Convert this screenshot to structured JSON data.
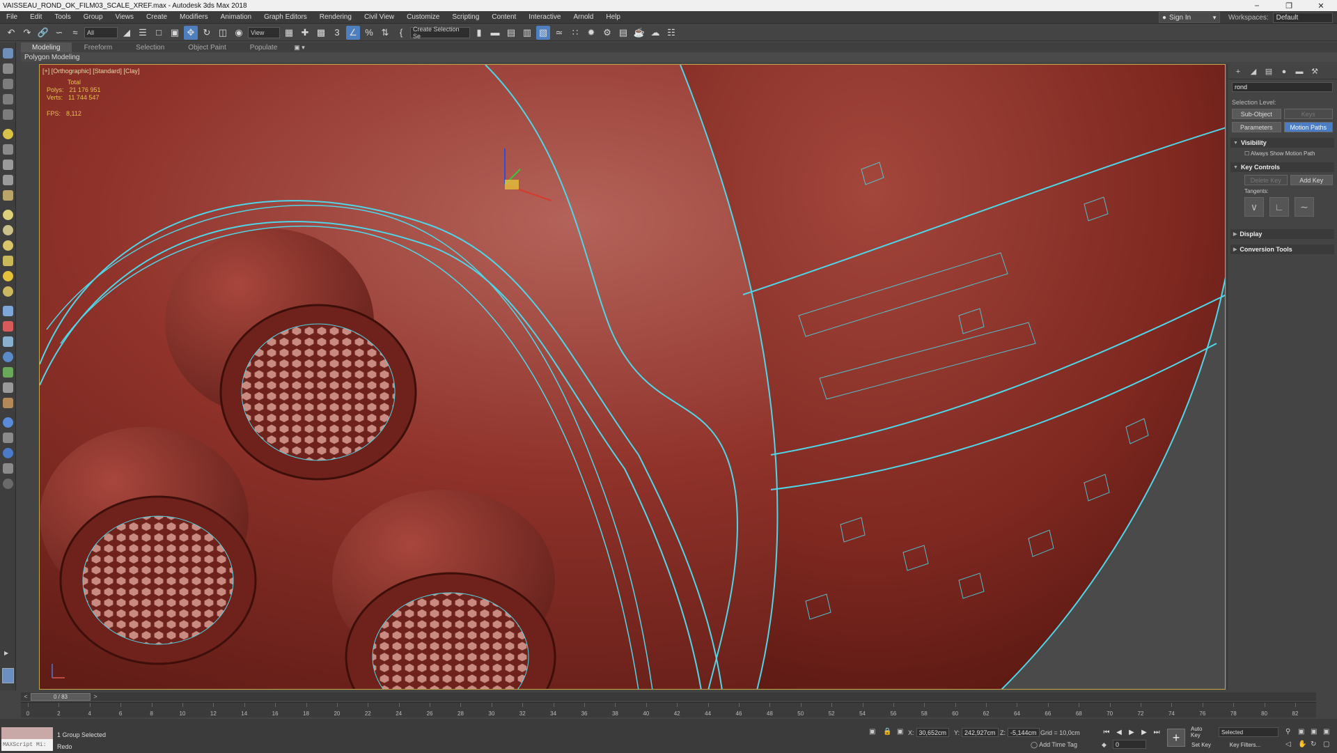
{
  "window": {
    "title": "VAISSEAU_ROND_OK_FILM03_SCALE_XREF.max - Autodesk 3ds Max 2018"
  },
  "menu": {
    "items": [
      "File",
      "Edit",
      "Tools",
      "Group",
      "Views",
      "Create",
      "Modifiers",
      "Animation",
      "Graph Editors",
      "Rendering",
      "Civil View",
      "Customize",
      "Scripting",
      "Content",
      "Interactive",
      "Arnold",
      "Help"
    ],
    "sign_in": "Sign In",
    "workspaces_label": "Workspaces:",
    "workspaces_value": "Default"
  },
  "toolbar": {
    "selection_filter": "All",
    "ref_coord": "View",
    "named_selection": "Create Selection Se"
  },
  "ribbon": {
    "tabs": [
      "Modeling",
      "Freeform",
      "Selection",
      "Object Paint",
      "Populate"
    ],
    "active_tab": "Modeling",
    "subpanel": "Polygon Modeling"
  },
  "viewport": {
    "label": "[+] [Orthographic] [Standard] [Clay]",
    "stats": {
      "total_label": "Total",
      "polys_label": "Polys:",
      "polys_value": "21 176 951",
      "verts_label": "Verts:",
      "verts_value": "11 744 547",
      "fps_label": "FPS:",
      "fps_value": "8,112"
    },
    "colors": {
      "surface": "#8a2f28",
      "highlight": "#b65a52",
      "shadow": "#5a1812",
      "edge": "#4fd6e8",
      "background": "#4a4a4a"
    }
  },
  "command_panel": {
    "object_name": "rond",
    "selection_level_label": "Selection Level:",
    "sub_object": "Sub-Object",
    "keys": "Keys",
    "parameters": "Parameters",
    "motion_paths": "Motion Paths",
    "visibility": "Visibility",
    "always_show": "Always Show Motion Path",
    "key_controls": "Key Controls",
    "delete_key": "Delete Key",
    "add_key": "Add Key",
    "tangents_label": "Tangents:",
    "display": "Display",
    "conversion_tools": "Conversion Tools"
  },
  "timeline": {
    "current": "0 / 83",
    "ticks": [
      "0",
      "2",
      "4",
      "6",
      "8",
      "10",
      "12",
      "14",
      "16",
      "18",
      "20",
      "22",
      "24",
      "26",
      "28",
      "30",
      "32",
      "34",
      "36",
      "38",
      "40",
      "42",
      "44",
      "46",
      "48",
      "50",
      "52",
      "54",
      "56",
      "58",
      "60",
      "62",
      "64",
      "66",
      "68",
      "70",
      "72",
      "74",
      "76",
      "78",
      "80",
      "82"
    ]
  },
  "status": {
    "maxscript": "MAXScript Mi:",
    "selection": "1 Group Selected",
    "prompt": "Redo",
    "x_label": "X:",
    "x_value": "30,652cm",
    "y_label": "Y:",
    "y_value": "242,927cm",
    "z_label": "Z:",
    "z_value": "-5,144cm",
    "grid": "Grid = 10,0cm",
    "add_time_tag": "Add Time Tag",
    "frame": "0",
    "auto_key": "Auto Key",
    "set_key": "Set Key",
    "selected": "Selected",
    "key_filters": "Key Filters..."
  }
}
